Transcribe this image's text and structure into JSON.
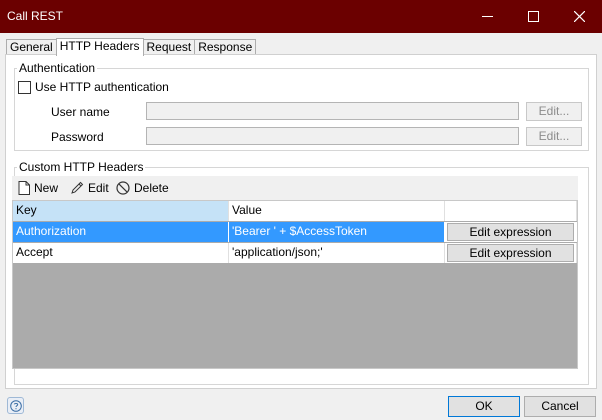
{
  "window": {
    "title": "Call REST",
    "controls": [
      "minimize-icon",
      "maximize-icon",
      "close-icon"
    ],
    "title_bar_color": "#6b0000"
  },
  "tabs": [
    {
      "label": "General",
      "active": false
    },
    {
      "label": "HTTP Headers",
      "active": true
    },
    {
      "label": "Request",
      "active": false
    },
    {
      "label": "Response",
      "active": false
    }
  ],
  "authentication": {
    "group_label": "Authentication",
    "use_http_auth_label": "Use HTTP authentication",
    "use_http_auth_checked": false,
    "username_label": "User name",
    "username_value": "",
    "username_edit_label": "Edit...",
    "password_label": "Password",
    "password_value": "",
    "password_edit_label": "Edit..."
  },
  "custom_headers": {
    "group_label": "Custom HTTP Headers",
    "toolbar": {
      "new_label": "New",
      "edit_label": "Edit",
      "delete_label": "Delete"
    },
    "columns": {
      "key": "Key",
      "value": "Value"
    },
    "rows": [
      {
        "key": "Authorization",
        "value": "'Bearer ' + $AccessToken",
        "button": "Edit expression",
        "selected": true
      },
      {
        "key": "Accept",
        "value": "'application/json;'",
        "button": "Edit expression",
        "selected": false
      }
    ]
  },
  "footer": {
    "help_icon": "question-mark-icon",
    "ok_label": "OK",
    "cancel_label": "Cancel"
  },
  "colors": {
    "selection": "#3399ff",
    "header_selected": "#c5e2f7",
    "grid_empty": "#ababab"
  }
}
